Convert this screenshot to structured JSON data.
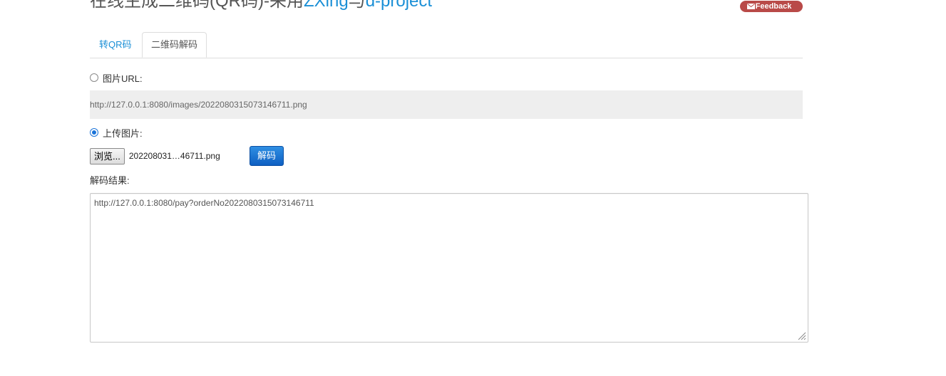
{
  "header": {
    "title_prefix": "在线生成二维码(QR码)-采用",
    "title_link1": "ZXing",
    "title_mid": "与",
    "title_link2": "d-project",
    "feedback_label": "Feedback"
  },
  "tabs": [
    {
      "label": "转QR码",
      "active": false
    },
    {
      "label": "二维码解码",
      "active": true
    }
  ],
  "url_option": {
    "label": "图片URL:",
    "selected": false,
    "value": "http://127.0.0.1:8080/images/2022080315073146711.png"
  },
  "upload_option": {
    "label": "上传图片:",
    "selected": true,
    "browse_label": "浏览...",
    "file_name": "202208031…46711.png"
  },
  "decode_button": {
    "label": "解码"
  },
  "result": {
    "label": "解码结果:",
    "value": "http://127.0.0.1:8080/pay?orderNo2022080315073146711"
  },
  "colors": {
    "link": "#1a8fd6",
    "feedback_bg": "#b94a48",
    "primary_button": "#0e5fc2",
    "url_field_bg": "#eeeeee"
  },
  "icons": {
    "feedback": "mail-icon",
    "radio_unchecked": "radio-off-icon",
    "radio_checked": "radio-on-icon",
    "resize": "resize-grip-icon"
  }
}
